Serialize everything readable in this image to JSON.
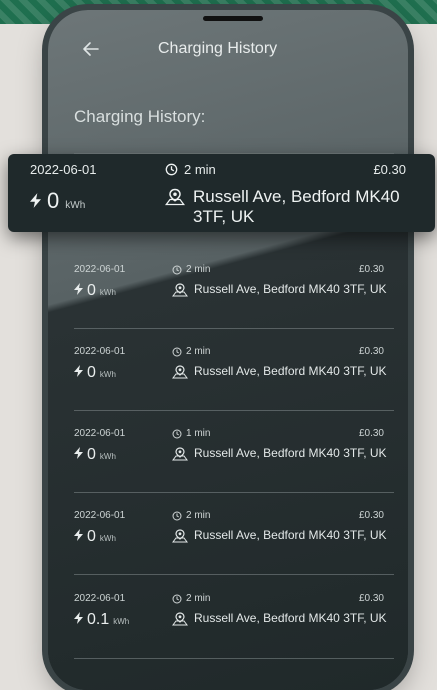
{
  "header": {
    "title": "Charging History"
  },
  "section_heading": "Charging History:",
  "featured": {
    "date": "2022-06-01",
    "duration": "2 min",
    "price": "£0.30",
    "energy": "0",
    "unit": "kWh",
    "address": "Russell Ave, Bedford MK40 3TF, UK"
  },
  "sessions": [
    {
      "date": "2022-06-01",
      "duration": "2 min",
      "price": "£0.30",
      "energy": "0",
      "unit": "kWh",
      "address": "Russell Ave, Bedford MK40 3TF, UK"
    },
    {
      "date": "2022-06-01",
      "duration": "2 min",
      "price": "£0.30",
      "energy": "0",
      "unit": "kWh",
      "address": "Russell Ave, Bedford MK40 3TF, UK"
    },
    {
      "date": "2022-06-01",
      "duration": "1 min",
      "price": "£0.30",
      "energy": "0",
      "unit": "kWh",
      "address": "Russell Ave, Bedford MK40 3TF, UK"
    },
    {
      "date": "2022-06-01",
      "duration": "2 min",
      "price": "£0.30",
      "energy": "0",
      "unit": "kWh",
      "address": "Russell Ave, Bedford MK40 3TF, UK"
    },
    {
      "date": "2022-06-01",
      "duration": "2 min",
      "price": "£0.30",
      "energy": "0.1",
      "unit": "kWh",
      "address": "Russell Ave, Bedford MK40 3TF, UK"
    }
  ],
  "icons": {
    "back": "back-arrow-icon",
    "timer": "timer-icon",
    "energy": "lightning-bolt-icon",
    "location": "location-pin-icon"
  },
  "colors": {
    "background": "#e3e0dc",
    "screen": "#1d2526",
    "card": "#1f292b",
    "text": "#e9eded",
    "banner": "#1f6f4f"
  }
}
